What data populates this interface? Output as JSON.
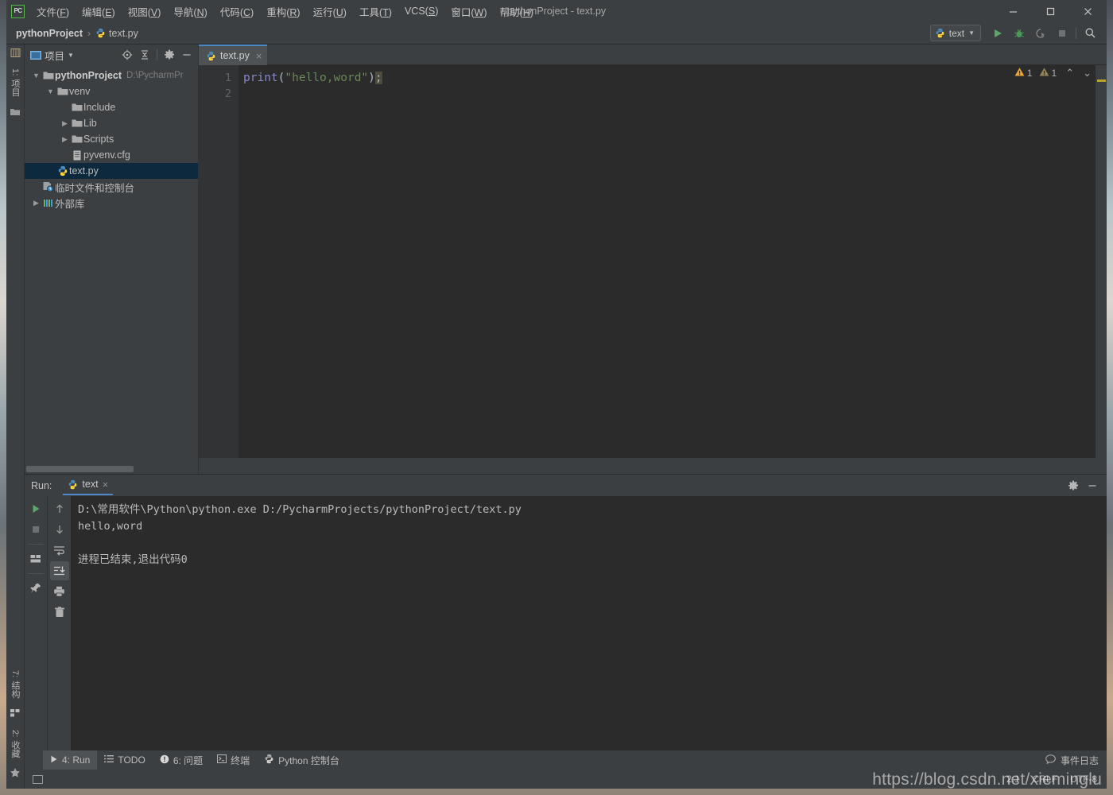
{
  "window": {
    "title": "pythonProject - text.py",
    "logo": "PC",
    "controls": {
      "minimize": "minimize-icon",
      "maximize": "maximize-icon",
      "close": "close-icon"
    }
  },
  "menubar": {
    "items": [
      {
        "label": "文件",
        "mnemonic": "F"
      },
      {
        "label": "编辑",
        "mnemonic": "E"
      },
      {
        "label": "视图",
        "mnemonic": "V"
      },
      {
        "label": "导航",
        "mnemonic": "N"
      },
      {
        "label": "代码",
        "mnemonic": "C"
      },
      {
        "label": "重构",
        "mnemonic": "R"
      },
      {
        "label": "运行",
        "mnemonic": "U"
      },
      {
        "label": "工具",
        "mnemonic": "T"
      },
      {
        "label": "VCS",
        "mnemonic": "S"
      },
      {
        "label": "窗口",
        "mnemonic": "W"
      },
      {
        "label": "帮助",
        "mnemonic": "H"
      }
    ]
  },
  "navbar": {
    "crumbs": [
      "pythonProject",
      "text.py"
    ],
    "separator": "›",
    "run_config": "text",
    "buttons": [
      "run-button",
      "debug-button",
      "coverage-button",
      "stop-button",
      "search-everywhere-button"
    ]
  },
  "left_stripe": {
    "top_tabs": [
      "1: 项目"
    ],
    "bottom_tabs": [
      "7: 结构",
      "2: 收藏"
    ]
  },
  "project_panel": {
    "title": "项目",
    "header_icons": [
      "select-opened-file-icon",
      "collapse-all-icon",
      "settings-gear-icon",
      "hide-icon"
    ],
    "tree": [
      {
        "label": "pythonProject",
        "path": "D:\\PycharmPr",
        "icon": "folder-icon",
        "indent": 0,
        "arrow": "expanded",
        "bold": true,
        "selected": false
      },
      {
        "label": "venv",
        "path": "",
        "icon": "folder-icon",
        "indent": 1,
        "arrow": "expanded",
        "bold": false,
        "selected": false
      },
      {
        "label": "Include",
        "path": "",
        "icon": "folder-icon",
        "indent": 2,
        "arrow": "none",
        "bold": false,
        "selected": false
      },
      {
        "label": "Lib",
        "path": "",
        "icon": "folder-icon",
        "indent": 2,
        "arrow": "collapsed",
        "bold": false,
        "selected": false
      },
      {
        "label": "Scripts",
        "path": "",
        "icon": "folder-icon",
        "indent": 2,
        "arrow": "collapsed",
        "bold": false,
        "selected": false
      },
      {
        "label": "pyvenv.cfg",
        "path": "",
        "icon": "config-file-icon",
        "indent": 2,
        "arrow": "none",
        "bold": false,
        "selected": false
      },
      {
        "label": "text.py",
        "path": "",
        "icon": "python-file-icon",
        "indent": 1,
        "arrow": "none",
        "bold": false,
        "selected": true
      },
      {
        "label": "临时文件和控制台",
        "path": "",
        "icon": "scratches-icon",
        "indent": 0,
        "arrow": "none",
        "bold": false,
        "selected": false
      },
      {
        "label": "外部库",
        "path": "",
        "icon": "external-libraries-icon",
        "indent": 0,
        "arrow": "collapsed",
        "bold": false,
        "selected": false
      }
    ]
  },
  "editor": {
    "tab": {
      "label": "text.py",
      "icon": "python-file-icon",
      "close": "×"
    },
    "line_numbers": [
      "1",
      "2"
    ],
    "code": {
      "fn": "print",
      "open_paren": "(",
      "string": "\"hello,word\"",
      "close_paren": ")",
      "semicolon": ";"
    },
    "inspections": {
      "warning_count": "1",
      "weak_warning_count": "1",
      "prev": "⌃",
      "next": "⌄"
    }
  },
  "run_panel": {
    "label": "Run:",
    "tab": {
      "label": "text",
      "icon": "python-file-icon",
      "close": "×"
    },
    "header_icons": [
      "settings-gear-icon",
      "hide-icon"
    ],
    "left_tools": [
      "rerun-button",
      "stop-button",
      "layout-button",
      "pin-tab-button"
    ],
    "right_tools": [
      "scroll-up-button",
      "scroll-down-button",
      "soft-wrap-button",
      "scroll-to-end-button",
      "print-button",
      "clear-all-button"
    ],
    "console_lines": [
      "D:\\常用软件\\Python\\python.exe D:/PycharmProjects/pythonProject/text.py",
      "hello,word",
      "",
      "进程已结束,退出代码0"
    ]
  },
  "bottom_bar": {
    "tabs": [
      {
        "label": "4: Run",
        "mnemonic": "4",
        "icon": "run-icon",
        "active": true
      },
      {
        "label": "TODO",
        "mnemonic": "",
        "icon": "todo-icon",
        "active": false
      },
      {
        "label": "6: 问题",
        "mnemonic": "6",
        "icon": "problems-icon",
        "active": false
      },
      {
        "label": "终端",
        "mnemonic": "",
        "icon": "terminal-icon",
        "active": false
      },
      {
        "label": "Python 控制台",
        "mnemonic": "",
        "icon": "python-console-icon",
        "active": false
      }
    ],
    "event_log": "事件日志"
  },
  "status_bar": {
    "caret_position": "2:1",
    "line_separator": "CRLF",
    "encoding": "UTF-8",
    "toggle_icon": "toggle-sidebar-icon",
    "watermark": "https://blog.csdn.net/xieminglu"
  }
}
